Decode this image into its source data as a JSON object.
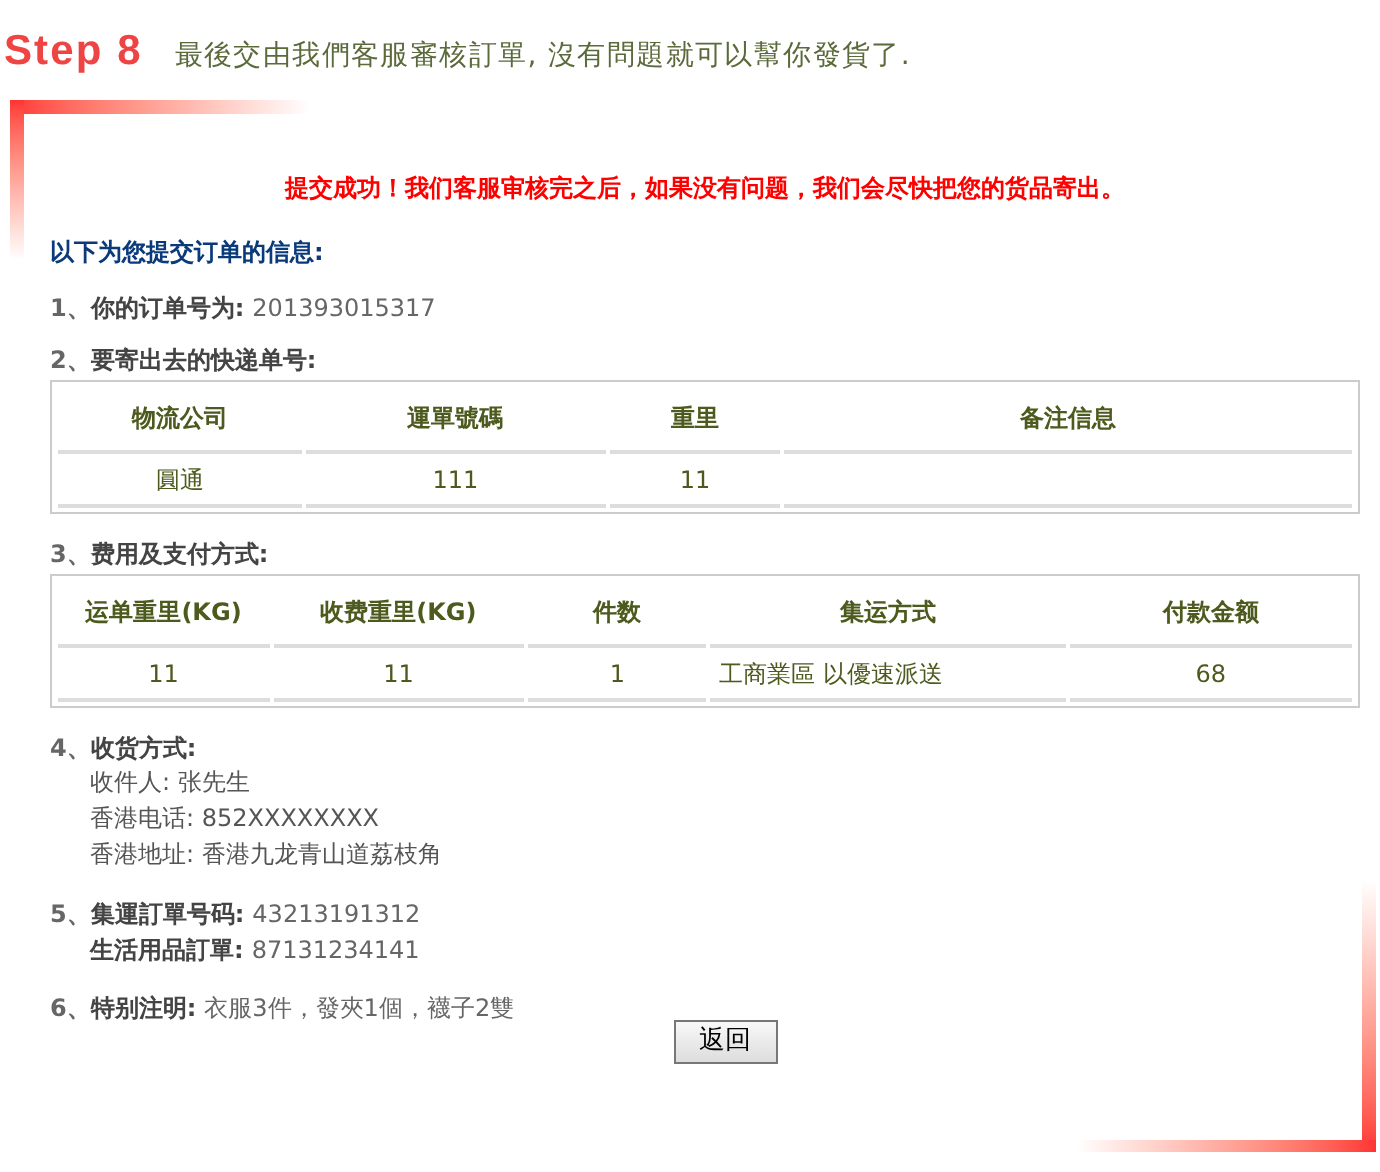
{
  "step": {
    "label": "Step 8",
    "subtitle": "最後交由我們客服審核訂單, 沒有問題就可以幫你發貨了."
  },
  "success_message": "提交成功！我们客服审核完之后，如果没有问题，我们会尽快把您的货品寄出。",
  "info_heading": "以下为您提交订单的信息:",
  "sections": [
    {
      "kind": "field",
      "number": "1、",
      "label": "你的订单号为:",
      "value": "201393015317"
    },
    {
      "kind": "table",
      "number": "2、",
      "label": "要寄出去的快递单号:",
      "columns": [
        "物流公司",
        "運單號碼",
        "重里",
        "备注信息"
      ],
      "rows": [
        [
          "圓通",
          "111",
          "11",
          ""
        ]
      ]
    },
    {
      "kind": "table",
      "number": "3、",
      "label": "费用及支付方式:",
      "columns": [
        "运单重里(KG)",
        "收费重里(KG)",
        "件数",
        "集运方式",
        "付款金额"
      ],
      "rows": [
        [
          "11",
          "11",
          "1",
          "工商業區 以優速派送",
          "68"
        ]
      ]
    },
    {
      "kind": "lines",
      "number": "4、",
      "label": "收货方式:",
      "lines": [
        "收件人: 张先生",
        "香港电话: 852XXXXXXXX",
        "香港地址: 香港九龙青山道荔枝角"
      ]
    },
    {
      "kind": "pairs",
      "number": "5、",
      "pairs": [
        {
          "label": "集運訂單号码:",
          "value": "43213191312"
        },
        {
          "label": "生活用品訂單:",
          "value": "87131234141"
        }
      ]
    },
    {
      "kind": "field",
      "number": "6、",
      "label": "特别注明:",
      "value": "衣服3件，發夾1個，襪子2雙"
    }
  ],
  "button": "返回"
}
